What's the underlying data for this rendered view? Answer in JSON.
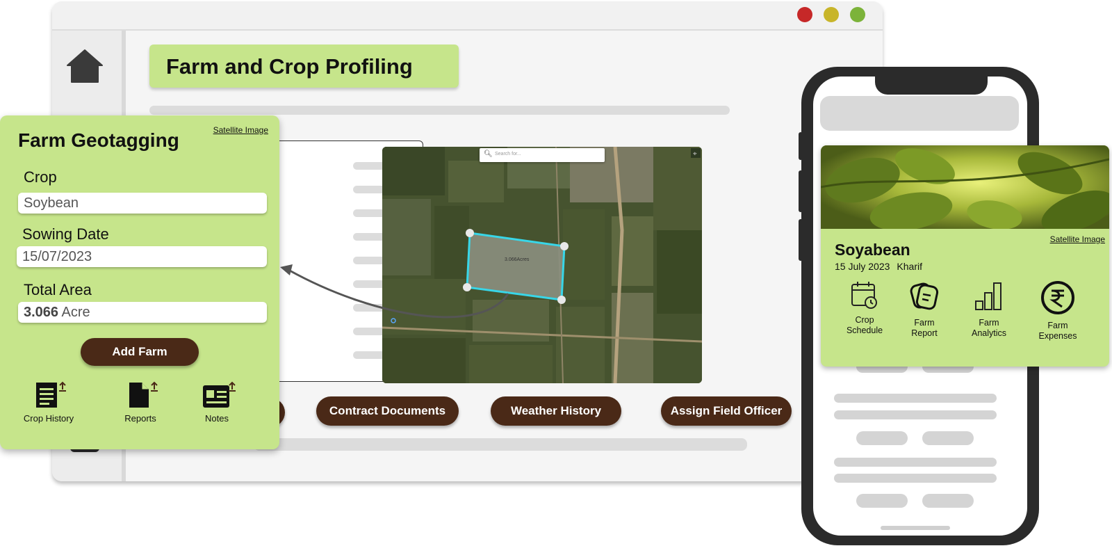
{
  "window": {
    "title": "Farm and Crop Profiling",
    "traffic_lights": [
      "#c62828",
      "#c8b52a",
      "#7cb33a"
    ]
  },
  "map": {
    "search_placeholder": "Search for...",
    "area_label": "3.066Acres"
  },
  "actions": {
    "contract_documents": "Contract Documents",
    "weather_history": "Weather History",
    "assign_field_officer": "Assign Field Officer"
  },
  "geotag": {
    "title": "Farm Geotagging",
    "satellite_link": "Satellite Image",
    "crop_label": "Crop",
    "crop_value": "Soybean",
    "sowing_label": "Sowing Date",
    "sowing_value": "15/07/2023",
    "area_label": "Total Area",
    "area_value": "3.066",
    "area_unit": " Acre",
    "add_button": "Add Farm",
    "tools": [
      {
        "label": "Crop History",
        "icon": "document-lines-icon"
      },
      {
        "label": "Reports",
        "icon": "file-icon"
      },
      {
        "label": "Notes",
        "icon": "id-card-icon"
      }
    ]
  },
  "crop_card": {
    "name": "Soyabean",
    "date": "15 July 2023",
    "season": "Kharif",
    "satellite_link": "Satellite Image",
    "features": [
      {
        "line1": "Crop",
        "line2": "Schedule",
        "icon": "calendar-clock-icon"
      },
      {
        "line1": "Farm",
        "line2": "Report",
        "icon": "report-icon"
      },
      {
        "line1": "Farm",
        "line2": "Analytics",
        "icon": "bar-chart-icon"
      },
      {
        "line1": "Farm",
        "line2": "Expenses",
        "icon": "rupee-icon"
      }
    ]
  },
  "colors": {
    "accent_green": "#c6e58b",
    "button_brown": "#4a2917",
    "polygon_outline": "#38d6e8"
  }
}
